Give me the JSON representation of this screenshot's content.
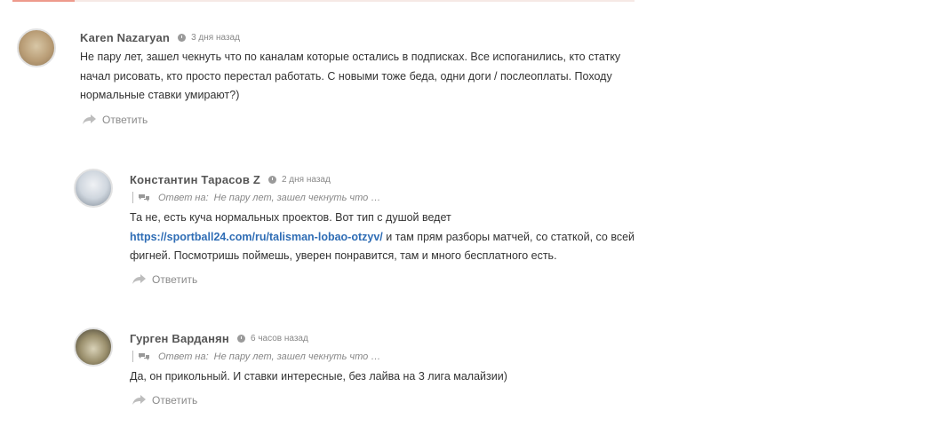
{
  "comments": [
    {
      "author": "Karen Nazaryan",
      "time": "3 дня назад",
      "text": "Не пару лет, зашел чекнуть что по каналам которые остались в подписках. Все испоганились, кто статку начал рисовать, кто просто перестал работать. С новыми тоже беда, одни доги / послеоплаты. Походу нормальные ставки умирают?)",
      "reply_label": "Ответить"
    },
    {
      "author": "Константин Тарасов Z",
      "time": "2 дня назад",
      "reply_to_label": "Ответ на:",
      "reply_to_text": "Не пару лет, зашел чекнуть что …",
      "text_before": "Та не, есть куча нормальных проектов. Вот тип с душой ведет",
      "link": "https://sportball24.com/ru/talisman-lobao-otzyv/",
      "text_after": " и там прям разборы матчей, со статкой, со всей фигней. Посмотришь поймешь, уверен понравится, там и много бесплатного есть.",
      "reply_label": "Ответить"
    },
    {
      "author": "Гурген Варданян",
      "time": "6 часов назад",
      "reply_to_label": "Ответ на:",
      "reply_to_text": "Не пару лет, зашел чекнуть что …",
      "text": "Да, он прикольный. И ставки интересные, без лайва на 3 лига малайзии)",
      "reply_label": "Ответить"
    }
  ],
  "icons": {
    "time": "clock-icon",
    "reply": "reply-arrow-icon",
    "reply_to": "speech-bubbles-icon"
  },
  "colors": {
    "link": "#2f6db5",
    "muted": "#888888",
    "author": "#555555"
  }
}
